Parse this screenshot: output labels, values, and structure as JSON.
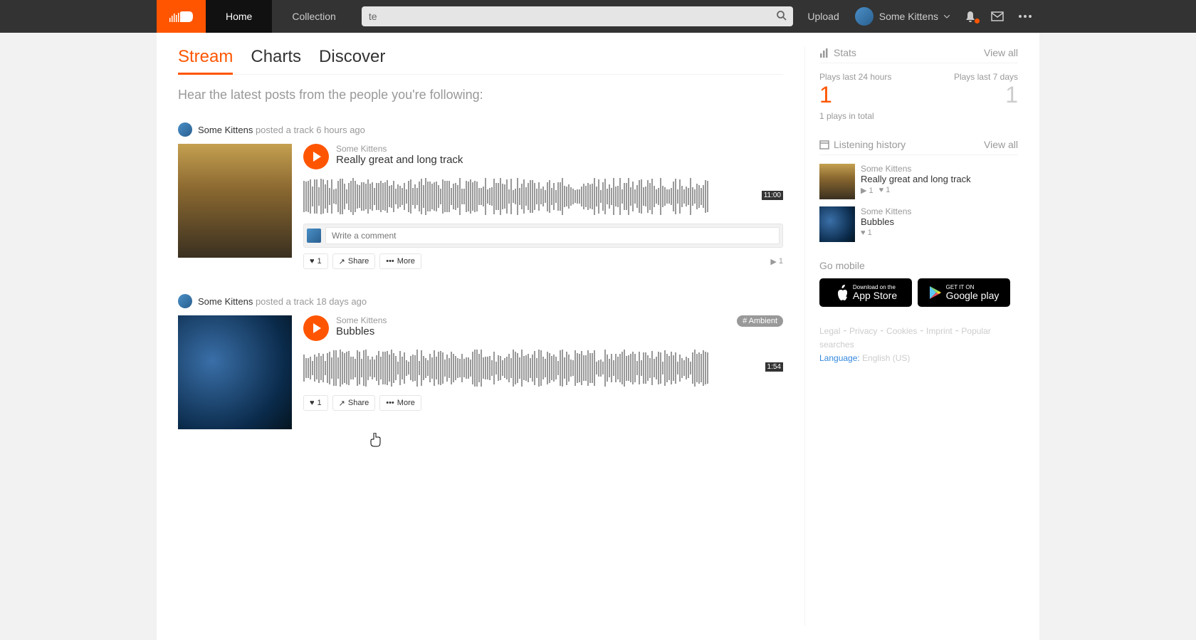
{
  "header": {
    "nav": [
      "Home",
      "Collection"
    ],
    "search_value": "te",
    "upload": "Upload",
    "username": "Some Kittens"
  },
  "tabs": [
    "Stream",
    "Charts",
    "Discover"
  ],
  "subtitle": "Hear the latest posts from the people you're following:",
  "posts": [
    {
      "who": "Some Kittens",
      "what": "posted a track 6 hours ago",
      "artist": "Some Kittens",
      "title": "Really great and long track",
      "duration": "11:00",
      "like_count": "1",
      "share_label": "Share",
      "more_label": "More",
      "comment_placeholder": "Write a comment",
      "play_count": "1",
      "tag": null
    },
    {
      "who": "Some Kittens",
      "what": "posted a track 18 days ago",
      "artist": "Some Kittens",
      "title": "Bubbles",
      "duration": "1:54",
      "like_count": "1",
      "share_label": "Share",
      "more_label": "More",
      "tag": "# Ambient"
    }
  ],
  "sidebar": {
    "stats_label": "Stats",
    "view_all": "View all",
    "plays24_label": "Plays last 24 hours",
    "plays24_value": "1",
    "plays7_label": "Plays last 7 days",
    "plays7_value": "1",
    "total": "1 plays in total",
    "history_label": "Listening history",
    "history": [
      {
        "artist": "Some Kittens",
        "title": "Really great and long track",
        "plays": "1",
        "likes": "1"
      },
      {
        "artist": "Some Kittens",
        "title": "Bubbles",
        "likes": "1"
      }
    ],
    "go_mobile": "Go mobile",
    "appstore_sub": "Download on the",
    "appstore": "App Store",
    "gplay_sub": "GET IT ON",
    "gplay": "Google play",
    "footer_links": "Legal ⁃ Privacy ⁃ Cookies ⁃ Imprint ⁃ Popular searches",
    "language_label": "Language:",
    "language_value": "English (US)"
  }
}
